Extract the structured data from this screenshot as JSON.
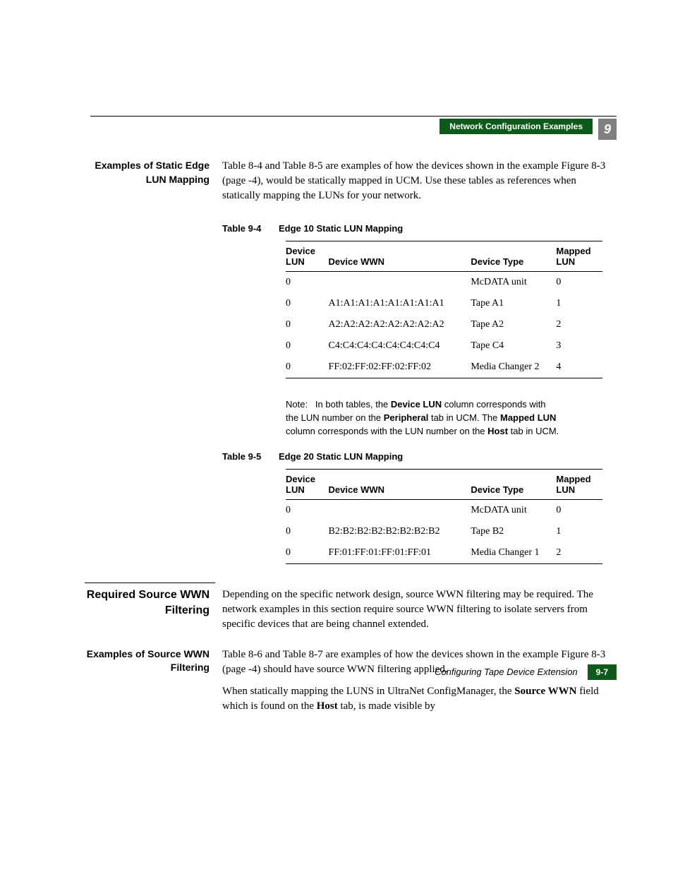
{
  "header": {
    "banner": "Network Configuration Examples",
    "chapter": "9"
  },
  "section1": {
    "heading": "Examples of Static Edge LUN Mapping",
    "body": "Table 8-4 and Table 8-5 are examples of how the devices shown in the example Figure 8-3 (page -4), would be statically mapped in UCM. Use these tables as references when statically mapping the LUNs for your network."
  },
  "table94": {
    "label": "Table 9-4",
    "title": "Edge 10 Static LUN Mapping",
    "headers": {
      "c1": "Device LUN",
      "c2": "Device WWN",
      "c3": "Device Type",
      "c4": "Mapped LUN"
    },
    "rows": [
      {
        "lun": "0",
        "wwn": "",
        "type": "McDATA unit",
        "map": "0"
      },
      {
        "lun": "0",
        "wwn": "A1:A1:A1:A1:A1:A1:A1:A1",
        "type": "Tape A1",
        "map": "1"
      },
      {
        "lun": "0",
        "wwn": "A2:A2:A2:A2:A2:A2:A2:A2",
        "type": "Tape A2",
        "map": "2"
      },
      {
        "lun": "0",
        "wwn": "C4:C4:C4:C4:C4:C4:C4:C4",
        "type": "Tape C4",
        "map": "3"
      },
      {
        "lun": "0",
        "wwn": "FF:02:FF:02:FF:02:FF:02",
        "type": "Media Changer 2",
        "map": "4"
      }
    ]
  },
  "note": {
    "prefix": "Note:",
    "t1": "In both tables, the ",
    "b1": "Device LUN",
    "t2": " column corresponds with the LUN number on the ",
    "b2": "Peripheral",
    "t3": " tab in UCM. The ",
    "b3": "Mapped LUN",
    "t4": " column corresponds with the LUN number on the ",
    "b4": "Host",
    "t5": " tab in UCM."
  },
  "table95": {
    "label": "Table 9-5",
    "title": "Edge 20 Static LUN Mapping",
    "headers": {
      "c1": "Device LUN",
      "c2": "Device WWN",
      "c3": "Device Type",
      "c4": "Mapped LUN"
    },
    "rows": [
      {
        "lun": "0",
        "wwn": "",
        "type": "McDATA unit",
        "map": "0"
      },
      {
        "lun": "0",
        "wwn": "B2:B2:B2:B2:B2:B2:B2:B2",
        "type": "Tape B2",
        "map": "1"
      },
      {
        "lun": "0",
        "wwn": "FF:01:FF:01:FF:01:FF:01",
        "type": "Media Changer 1",
        "map": "2"
      }
    ]
  },
  "section2": {
    "heading": "Required Source WWN Filtering",
    "body": "Depending on the specific network design, source WWN filtering may be required. The network examples in this section require source WWN filtering to isolate servers from specific devices that are being channel extended."
  },
  "section3": {
    "heading": "Examples of Source WWN Filtering",
    "p1": "Table 8-6 and Table 8-7 are examples of how the devices shown in the example Figure 8-3 (page -4) should have source WWN filtering applied.",
    "p2a": "When statically mapping the LUNS in UltraNet ConfigManager, the ",
    "p2b1": "Source WWN",
    "p2c": " field which is found on the ",
    "p2b2": "Host",
    "p2d": " tab, is made visible by"
  },
  "footer": {
    "title": "Configuring Tape Device Extension",
    "page": "9-7"
  }
}
